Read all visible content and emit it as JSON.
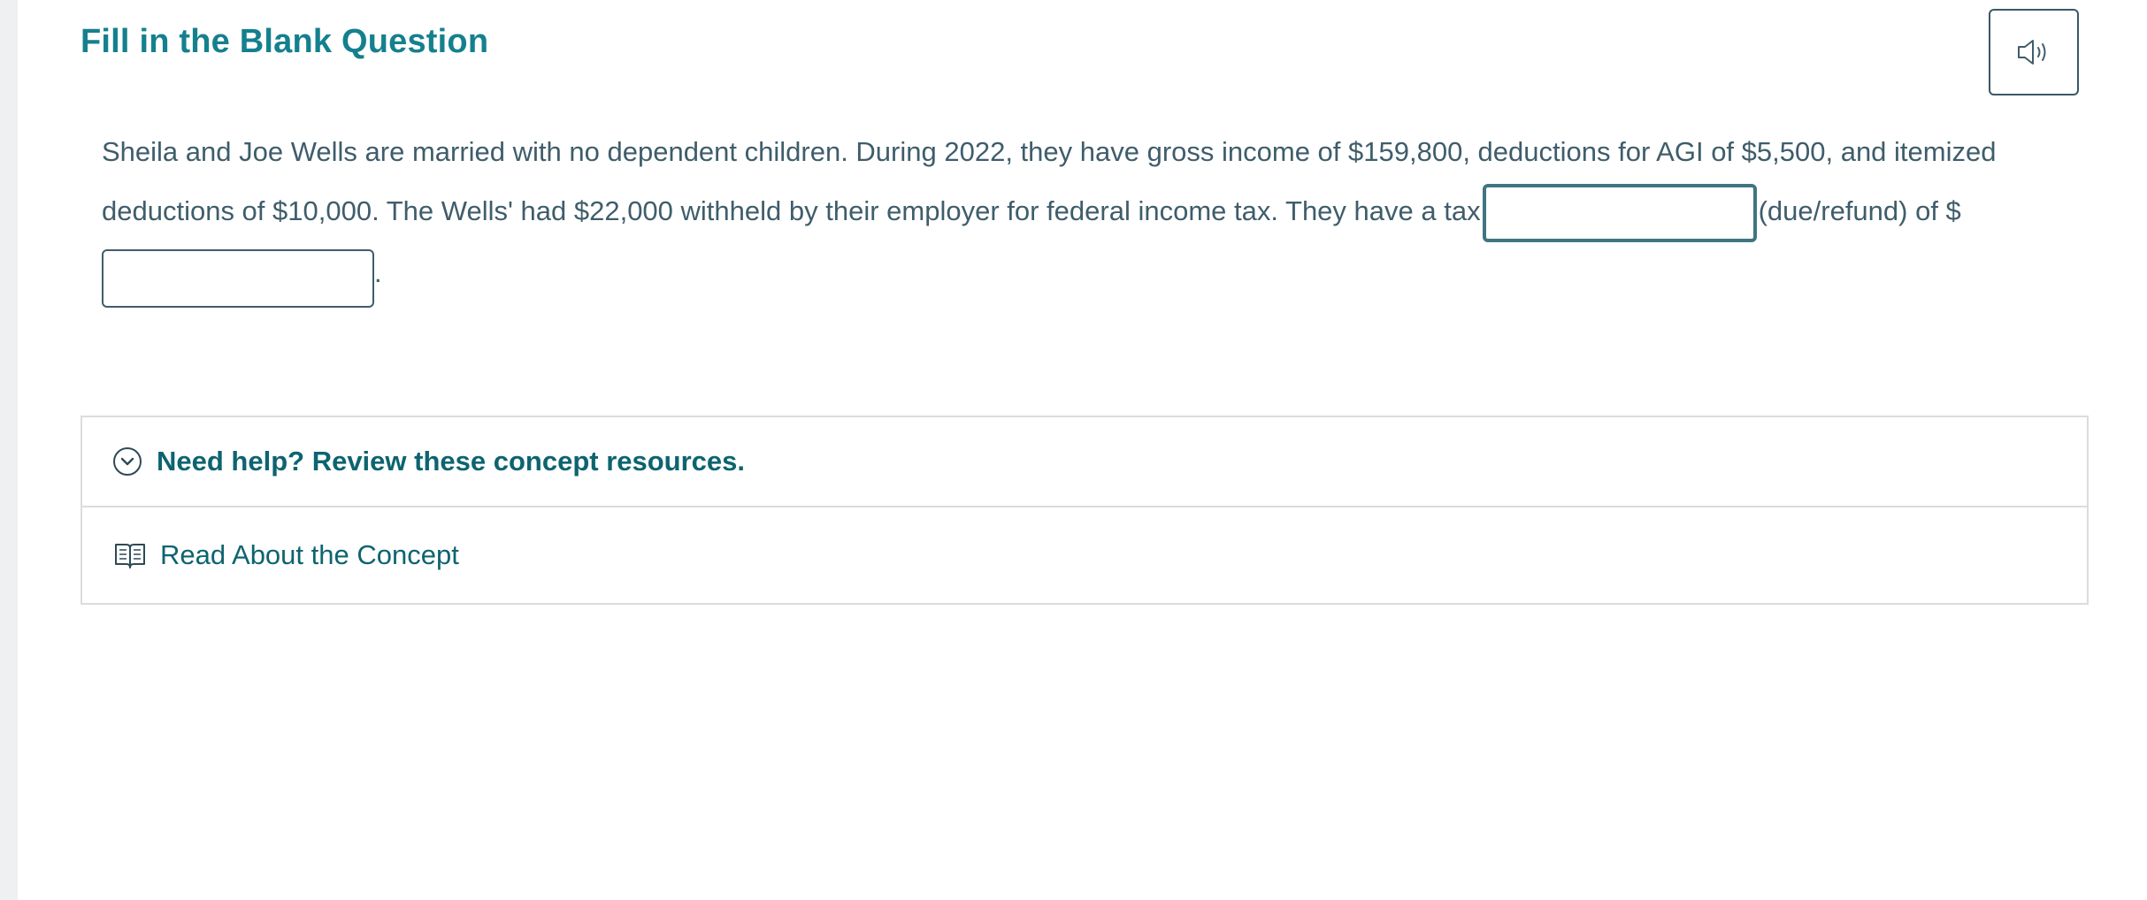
{
  "header": {
    "title": "Fill in the Blank Question",
    "audio_icon": "speaker-icon"
  },
  "question": {
    "text_part1": "Sheila and Joe Wells are married with no dependent children. During 2022, they have gross income of $159,800, deductions for AGI of $5,500, and itemized deductions of $10,000. The Wells' had $22,000 withheld by their employer for federal income tax. They have a tax",
    "blank1_value": "",
    "text_part2": "(due/refund) of $",
    "blank2_value": "",
    "text_part3": "."
  },
  "resources": {
    "header_label": "Need help? Review these concept resources.",
    "header_icon": "chevron-down-circle-icon",
    "items": [
      {
        "label": "Read About the Concept",
        "icon": "book-icon"
      }
    ]
  },
  "colors": {
    "title": "#15808d",
    "body_text": "#3f5d6b",
    "link": "#0d6470",
    "border": "#d9dcdf"
  }
}
